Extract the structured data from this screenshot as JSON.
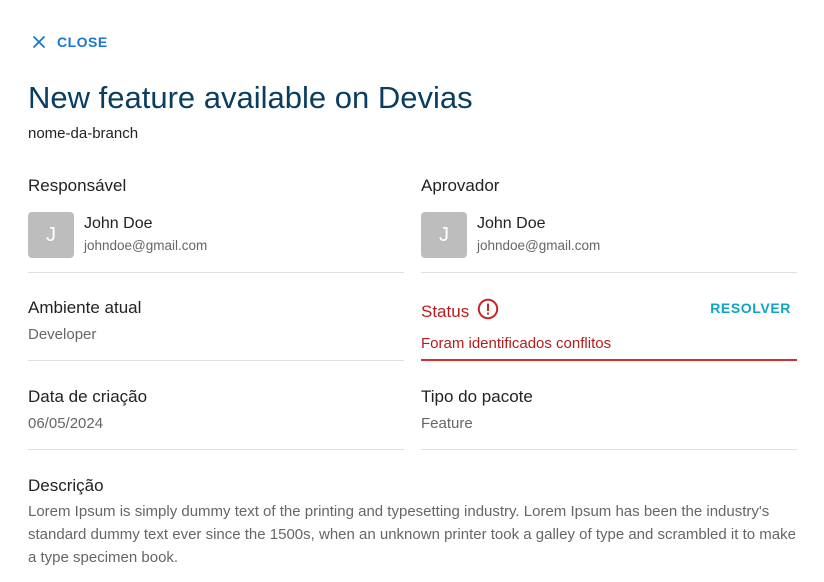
{
  "close_label": "CLOSE",
  "title": "New feature available on Devias",
  "branch": "nome-da-branch",
  "responsavel": {
    "label": "Responsável",
    "avatar_initial": "J",
    "name": "John Doe",
    "email": "johndoe@gmail.com"
  },
  "aprovador": {
    "label": "Aprovador",
    "avatar_initial": "J",
    "name": "John Doe",
    "email": "johndoe@gmail.com"
  },
  "ambiente": {
    "label": "Ambiente atual",
    "value": "Developer"
  },
  "status": {
    "label": "Status",
    "value": "Foram identificados conflitos",
    "action_label": "RESOLVER",
    "color": "#b71c1c",
    "icon": "error-circle-icon"
  },
  "data_criacao": {
    "label": "Data de criação",
    "value": "06/05/2024"
  },
  "tipo_pacote": {
    "label": "Tipo do pacote",
    "value": "Feature"
  },
  "descricao": {
    "label": "Descrição",
    "text": "Lorem Ipsum is simply dummy text of the printing and typesetting industry. Lorem Ipsum has been the industry's standard dummy text ever since the 1500s, when an unknown printer took a galley of type and scrambled it to make a type specimen book."
  },
  "colors": {
    "accent": "#1976d2",
    "title": "#0a3d62",
    "resolve": "#0ea5c4",
    "avatar": "#bdbdbd"
  }
}
